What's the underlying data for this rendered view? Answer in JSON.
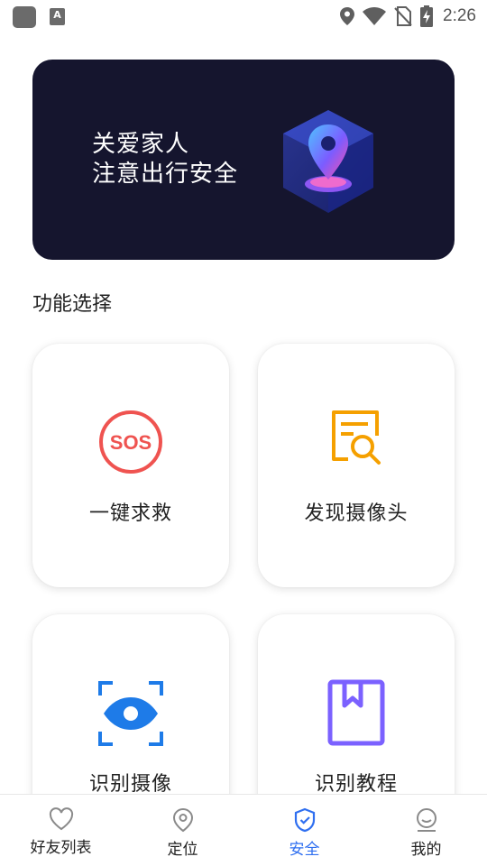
{
  "status_bar": {
    "time": "2:26",
    "icons": [
      "app-icon",
      "a-icon",
      "location-icon",
      "wifi-icon",
      "no-sim-icon",
      "battery-charging-icon"
    ]
  },
  "banner": {
    "line1": "关爱家人",
    "line2": "注意出行安全",
    "art_icon": "location-cube-icon"
  },
  "section_title": "功能选择",
  "features": [
    {
      "label": "一键求救",
      "icon": "sos-icon",
      "color": "#ef5350"
    },
    {
      "label": "发现摄像头",
      "icon": "document-search-icon",
      "color": "#f5a000"
    },
    {
      "label": "识别摄像",
      "icon": "eye-scan-icon",
      "color": "#1e7be8"
    },
    {
      "label": "识别教程",
      "icon": "bookmark-book-icon",
      "color": "#7b61ff"
    }
  ],
  "bottom_nav": {
    "items": [
      {
        "label": "好友列表",
        "icon": "heart-icon",
        "active": false
      },
      {
        "label": "定位",
        "icon": "location-pin-icon",
        "active": false
      },
      {
        "label": "安全",
        "icon": "shield-check-icon",
        "active": true
      },
      {
        "label": "我的",
        "icon": "profile-face-icon",
        "active": false
      }
    ],
    "active_color": "#2f6ff0"
  }
}
